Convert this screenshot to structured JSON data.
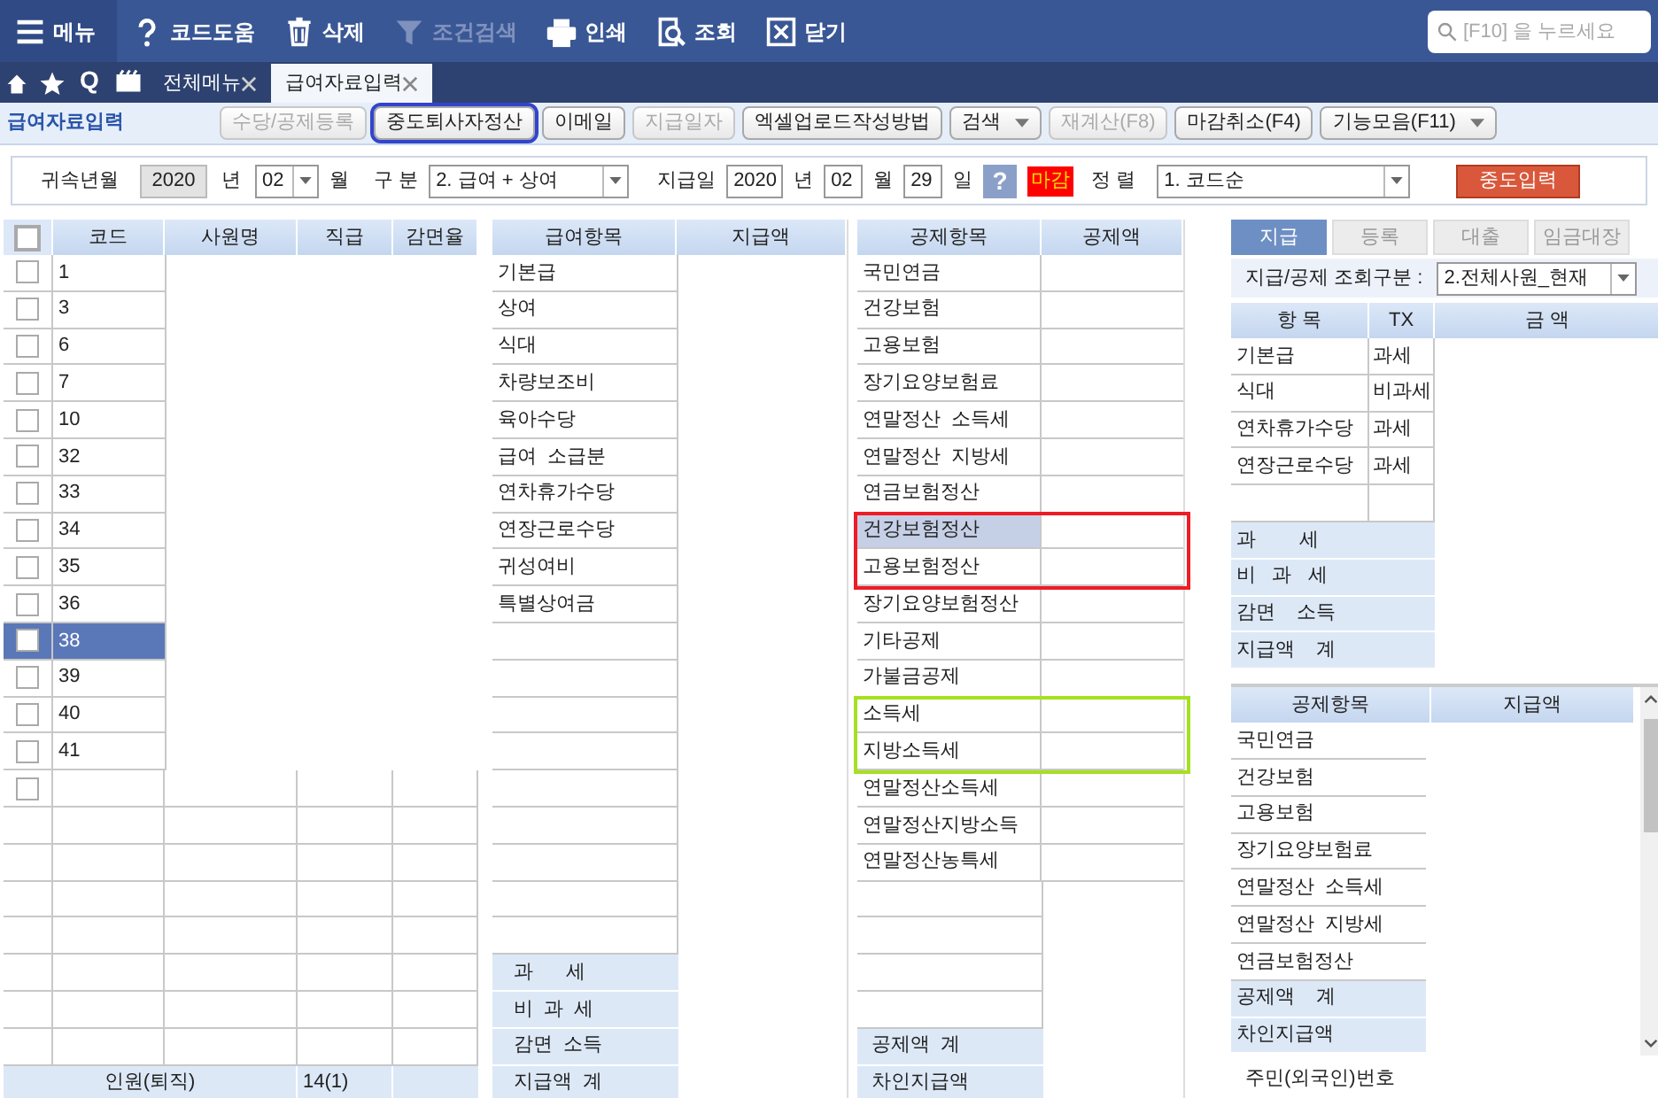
{
  "toolbar": {
    "items": [
      {
        "label": "메뉴",
        "kind": "menu",
        "disabled": false
      },
      {
        "label": "코드도움",
        "kind": "help",
        "disabled": false
      },
      {
        "label": "삭제",
        "kind": "trash",
        "disabled": false
      },
      {
        "label": "조건검색",
        "kind": "filter",
        "disabled": true
      },
      {
        "label": "인쇄",
        "kind": "print",
        "disabled": false
      },
      {
        "label": "조회",
        "kind": "search",
        "disabled": false
      },
      {
        "label": "닫기",
        "kind": "close",
        "disabled": false
      }
    ],
    "search_placeholder": "[F10] 을 누르세요"
  },
  "shortcut_label": "Q",
  "tabs": [
    {
      "label": "전체메뉴",
      "selected": false
    },
    {
      "label": "급여자료입력",
      "selected": true
    }
  ],
  "page_title": "급여자료입력",
  "actions": [
    {
      "label": "수당/공제등록",
      "disabled": true,
      "focused": false,
      "dropdown": false
    },
    {
      "label": "중도퇴사자정산",
      "disabled": false,
      "focused": true,
      "dropdown": false
    },
    {
      "label": "이메일",
      "disabled": false,
      "focused": false,
      "dropdown": false
    },
    {
      "label": "지급일자",
      "disabled": true,
      "focused": false,
      "dropdown": false
    },
    {
      "label": "엑셀업로드작성방법",
      "disabled": false,
      "focused": false,
      "dropdown": false
    },
    {
      "label": "검색",
      "disabled": false,
      "focused": false,
      "dropdown": true
    },
    {
      "label": "재계산(F8)",
      "disabled": true,
      "focused": false,
      "dropdown": false
    },
    {
      "label": "마감취소(F4)",
      "disabled": false,
      "focused": false,
      "dropdown": false
    },
    {
      "label": "기능모음(F11)",
      "disabled": false,
      "focused": false,
      "dropdown": true
    }
  ],
  "filters": {
    "period_label": "귀속년월",
    "period_year": "2020",
    "year_unit": "년",
    "period_month": "02",
    "month_unit": "월",
    "type_label": "구 분",
    "type_value": "2. 급여 + 상여",
    "pay_date_label": "지급일",
    "pay_year": "2020",
    "pay_year_unit": "년",
    "pay_month": "02",
    "pay_month_unit": "월",
    "pay_day": "29",
    "pay_day_unit": "일",
    "help": "?",
    "closed_badge": "마감",
    "sort_label": "정 렬",
    "sort_value": "1. 코드순",
    "interim_button": "중도입력"
  },
  "employees": {
    "columns": [
      "코드",
      "사원명",
      "직급",
      "감면율"
    ],
    "all_checked": false,
    "rows": [
      {
        "code": "1",
        "checked": false,
        "selected": false
      },
      {
        "code": "3",
        "checked": false,
        "selected": false
      },
      {
        "code": "6",
        "checked": false,
        "selected": false
      },
      {
        "code": "7",
        "checked": false,
        "selected": false
      },
      {
        "code": "10",
        "checked": false,
        "selected": false
      },
      {
        "code": "32",
        "checked": false,
        "selected": false
      },
      {
        "code": "33",
        "checked": false,
        "selected": false
      },
      {
        "code": "34",
        "checked": false,
        "selected": false
      },
      {
        "code": "35",
        "checked": false,
        "selected": false
      },
      {
        "code": "36",
        "checked": false,
        "selected": false
      },
      {
        "code": "38",
        "checked": false,
        "selected": true
      },
      {
        "code": "39",
        "checked": false,
        "selected": false
      },
      {
        "code": "40",
        "checked": false,
        "selected": false
      },
      {
        "code": "41",
        "checked": false,
        "selected": false
      }
    ],
    "new_row_checked": false,
    "footer_label": "인원(퇴직)",
    "footer_count": "14(1)"
  },
  "pay_items": {
    "columns": [
      "급여항목",
      "지급액"
    ],
    "rows": [
      "기본급",
      "상여",
      "식대",
      "차량보조비",
      "육아수당",
      "급여  소급분",
      "연차휴가수당",
      "연장근로수당",
      "귀성여비",
      "특별상여금"
    ],
    "summary": [
      "과      세",
      "비  과  세",
      "감면  소득",
      "지급액  계"
    ]
  },
  "deductions": {
    "columns": [
      "공제항목",
      "공제액"
    ],
    "rows": [
      {
        "label": "국민연금",
        "selected": false
      },
      {
        "label": "건강보험",
        "selected": false
      },
      {
        "label": "고용보험",
        "selected": false
      },
      {
        "label": "장기요양보험료",
        "selected": false
      },
      {
        "label": "연말정산  소득세",
        "selected": false
      },
      {
        "label": "연말정산  지방세",
        "selected": false
      },
      {
        "label": "연금보험정산",
        "selected": false
      },
      {
        "label": "건강보험정산",
        "selected": true,
        "color": "#ee1c25"
      },
      {
        "label": "고용보험정산",
        "selected": false,
        "color": "#ee1c25"
      },
      {
        "label": "장기요양보험정산",
        "selected": false
      },
      {
        "label": "기타공제",
        "selected": false
      },
      {
        "label": "가불금공제",
        "selected": false
      },
      {
        "label": "소득세",
        "selected": false,
        "color": "#a6e022"
      },
      {
        "label": "지방소득세",
        "selected": false,
        "color": "#a6e022"
      },
      {
        "label": "연말정산소득세",
        "selected": false
      },
      {
        "label": "연말정산지방소득",
        "selected": false
      },
      {
        "label": "연말정산농특세",
        "selected": false
      }
    ],
    "summary": [
      "공제액  계",
      "차인지급액"
    ]
  },
  "right_panel": {
    "tabs": [
      {
        "label": "지급",
        "selected": true
      },
      {
        "label": "등록",
        "selected": false
      },
      {
        "label": "대출",
        "selected": false
      },
      {
        "label": "임금대장",
        "selected": false
      }
    ],
    "query_label": "지급/공제 조회구분 :",
    "query_value": "2.전체사원_현재",
    "pay_table": {
      "columns": [
        "항 목",
        "TX",
        "금 액"
      ],
      "rows": [
        {
          "item": "기본급",
          "tx": "과세"
        },
        {
          "item": "식대",
          "tx": "비과세"
        },
        {
          "item": "연차휴가수당",
          "tx": "과세"
        },
        {
          "item": "연장근로수당",
          "tx": "과세"
        }
      ],
      "summary": [
        "과        세",
        "비   과   세",
        "감면    소득",
        "지급액    계"
      ]
    },
    "deduction_table": {
      "columns": [
        "공제항목",
        "지급액"
      ],
      "rows": [
        "국민연금",
        "건강보험",
        "고용보험",
        "장기요양보험료",
        "연말정산  소득세",
        "연말정산  지방세",
        "연금보험정산"
      ],
      "summary": [
        "공제액    계",
        "차인지급액"
      ]
    },
    "footer_label": "주민(외국인)번호"
  }
}
